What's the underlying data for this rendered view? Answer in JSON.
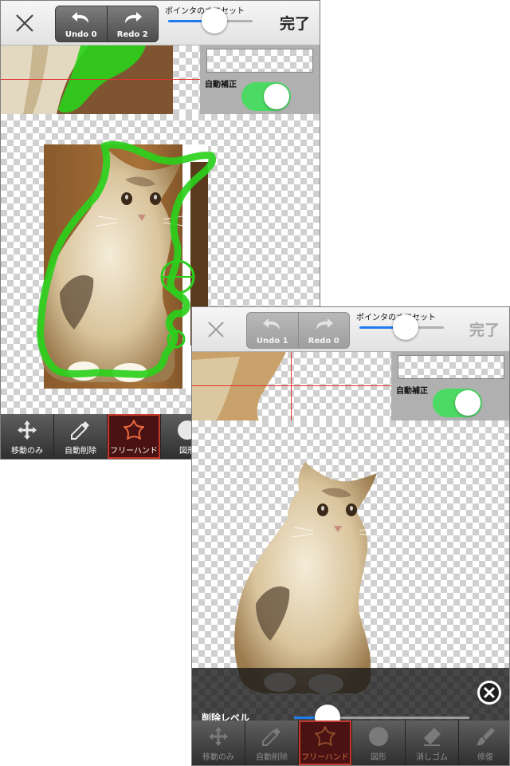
{
  "screens": [
    {
      "topbar": {
        "undo_label": "Undo 0",
        "redo_label": "Redo 2",
        "pointer_offset_label": "ポインタのオフセット",
        "pointer_offset_value": 0.55,
        "done_label": "完了"
      },
      "side": {
        "auto_correct_label": "自動補正",
        "auto_correct_on": true
      },
      "toolbar": {
        "tools": [
          {
            "label": "移動のみ",
            "icon": "move-icon"
          },
          {
            "label": "自動削除",
            "icon": "dropper-icon"
          },
          {
            "label": "フリーハンド",
            "icon": "star-icon",
            "active": true
          },
          {
            "label": "図形",
            "icon": "shape-icon"
          }
        ]
      }
    },
    {
      "topbar": {
        "undo_label": "Undo 1",
        "redo_label": "Redo 0",
        "pointer_offset_label": "ポインタのオフセット",
        "pointer_offset_value": 0.55,
        "done_label": "完了"
      },
      "side": {
        "auto_correct_label": "自動補正",
        "auto_correct_on": true
      },
      "delete_panel": {
        "label": "削除レベル",
        "level": 0.19
      },
      "toolbar": {
        "tools": [
          {
            "label": "移動のみ",
            "icon": "move-icon"
          },
          {
            "label": "自動削除",
            "icon": "dropper-icon"
          },
          {
            "label": "フリーハンド",
            "icon": "star-icon",
            "active": true
          },
          {
            "label": "図形",
            "icon": "shape-icon"
          },
          {
            "label": "消しゴム",
            "icon": "eraser-icon"
          },
          {
            "label": "修復",
            "icon": "brush-icon"
          }
        ]
      }
    }
  ],
  "colors": {
    "selection_green": "#2bd01c",
    "toggle_green": "#4cd964",
    "crosshair_red": "#e2312d",
    "active_tool_border": "#c23a2b",
    "slider_blue": "#1c7cf0"
  }
}
